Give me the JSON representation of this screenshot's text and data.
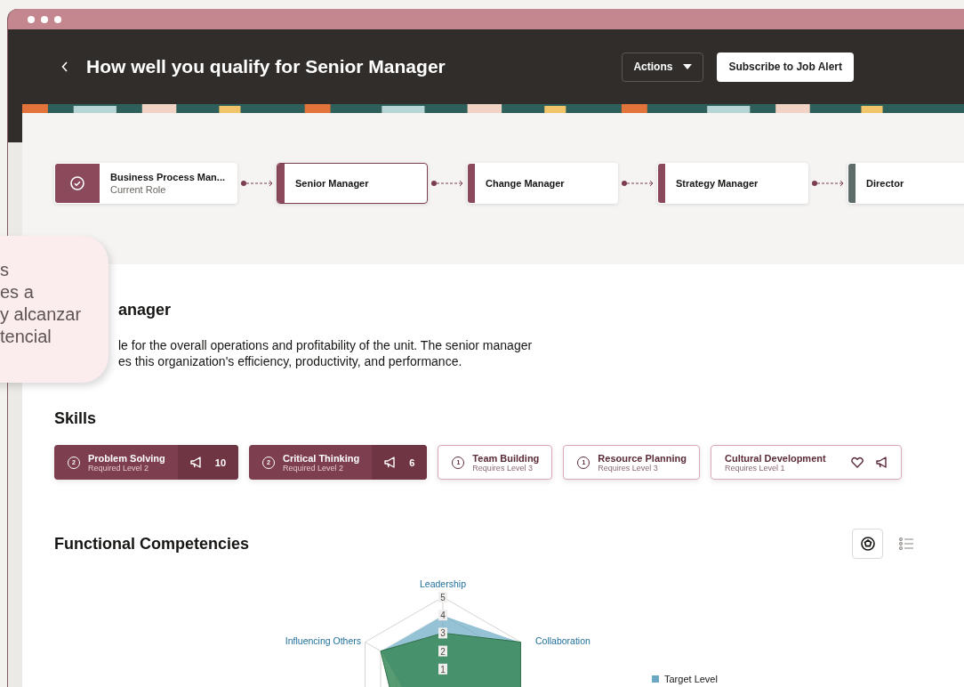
{
  "window": {
    "title": "How well you qualify for Senior Manager"
  },
  "header_actions": {
    "actions": "Actions",
    "subscribe": "Subscribe to Job Alert"
  },
  "career_path": [
    {
      "kind": "current",
      "title": "Business Process Man...",
      "subtitle": "Current Role",
      "selected": false,
      "color": "#8b4a5c"
    },
    {
      "kind": "role",
      "title": "Senior Manager",
      "selected": true,
      "color": "#8b4a5c"
    },
    {
      "kind": "role",
      "title": "Change Manager",
      "selected": false,
      "color": "#8b4a5c"
    },
    {
      "kind": "role",
      "title": "Strategy Manager",
      "selected": false,
      "color": "#8b4a5c"
    },
    {
      "kind": "role",
      "title": "Director",
      "selected": false,
      "color": "#5e6c6a"
    }
  ],
  "callout": {
    "lines": [
      "s",
      "es a",
      "y alcanzar",
      "tencial"
    ]
  },
  "role": {
    "heading": "anager",
    "description_lines": [
      "le for the overall operations and profitability of the unit. The senior manager",
      "es this organization's efficiency, productivity, and performance."
    ]
  },
  "skills": {
    "heading": "Skills",
    "items": [
      {
        "kind": "filled",
        "name": "Problem Solving",
        "requirement": "Required Level 2",
        "badge": "2",
        "count": "10",
        "megaphone": true,
        "heart": false
      },
      {
        "kind": "filled",
        "name": "Critical Thinking",
        "requirement": "Required Level 2",
        "badge": "2",
        "count": "6",
        "megaphone": true,
        "heart": false
      },
      {
        "kind": "outline",
        "name": "Team Building",
        "requirement": "Requires Level 3",
        "badge": "1",
        "megaphone": false,
        "heart": false
      },
      {
        "kind": "outline",
        "name": "Resource Planning",
        "requirement": "Requires Level 3",
        "badge": "1",
        "megaphone": false,
        "heart": false
      },
      {
        "kind": "outline",
        "name": "Cultural Development",
        "requirement": "Requires Level 1",
        "megaphone": true,
        "heart": true
      }
    ]
  },
  "competencies": {
    "heading": "Functional Competencies",
    "view_toggle": [
      {
        "kind": "radar",
        "selected": true
      },
      {
        "kind": "list",
        "selected": false
      }
    ],
    "chart": {
      "axes": [
        "Leadership",
        "Collaboration",
        "Influencing Others"
      ],
      "ticks": [
        "5",
        "4",
        "3",
        "2",
        "1"
      ],
      "legend": [
        {
          "name": "Target Level",
          "color": "#6aa8c4"
        }
      ]
    }
  }
}
